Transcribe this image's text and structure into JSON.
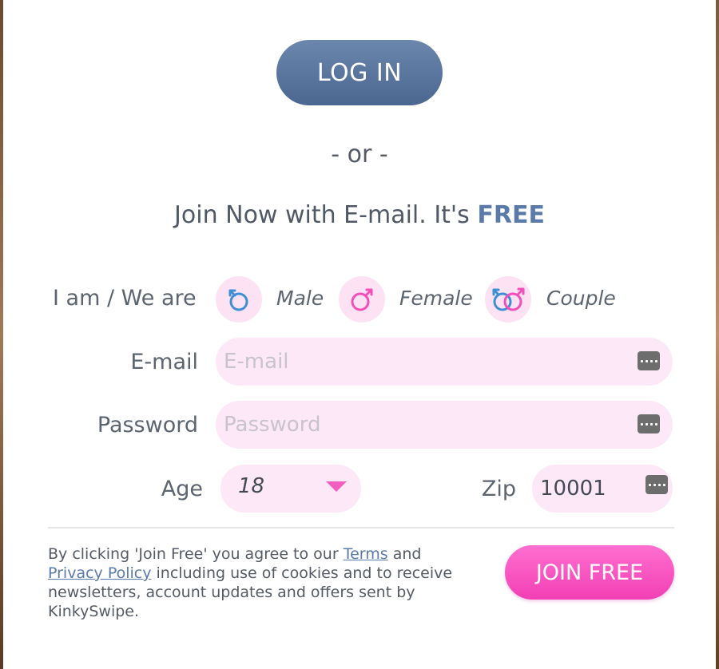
{
  "login_button": "LOG IN",
  "separator": "- or -",
  "join_prompt": {
    "text": "Join Now with E-mail. It's",
    "highlight": "FREE"
  },
  "gender": {
    "label": "I am / We are",
    "options": [
      {
        "label": "Male",
        "icon": "male-symbol-icon"
      },
      {
        "label": "Female",
        "icon": "female-symbol-icon"
      },
      {
        "label": "Couple",
        "icon": "couple-symbol-icon"
      }
    ]
  },
  "email": {
    "label": "E-mail",
    "placeholder": "E-mail",
    "value": ""
  },
  "password": {
    "label": "Password",
    "placeholder": "Password",
    "value": ""
  },
  "age": {
    "label": "Age",
    "value": "18"
  },
  "zip": {
    "label": "Zip",
    "value": "10001"
  },
  "legal": {
    "prefix": "By clicking 'Join Free' you agree to our",
    "terms_link": "Terms",
    "and": "and",
    "privacy_link": "Privacy Policy",
    "suffix": "including use of cookies and to receive newsletters, account updates and offers sent by KinkySwipe."
  },
  "join_button": "JOIN FREE",
  "colors": {
    "login_button": "#5b77a0",
    "join_button": "#f44fbe",
    "field_background": "#fde8f7",
    "accent_blue": "#5a7aaa"
  }
}
